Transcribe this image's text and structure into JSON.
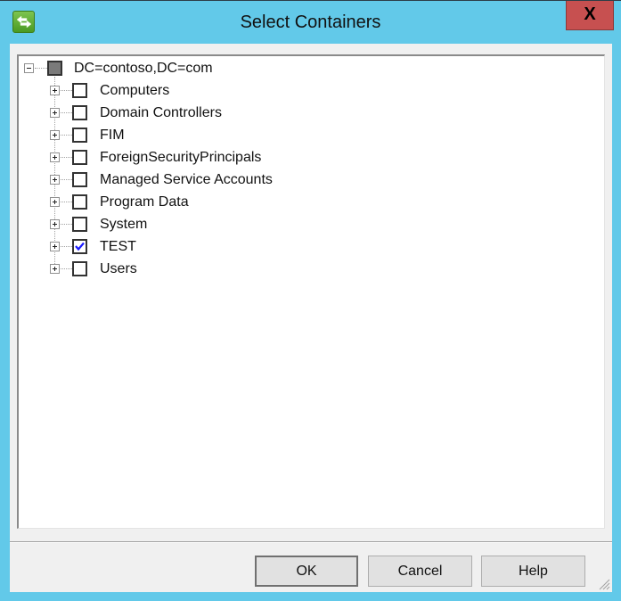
{
  "window": {
    "title": "Select Containers",
    "close_label": "X",
    "app_icon": "green-arrows-icon"
  },
  "tree": {
    "root": {
      "label": "DC=contoso,DC=com",
      "state": "indeterminate",
      "expanded": true
    },
    "children": [
      {
        "label": "Computers",
        "checked": false
      },
      {
        "label": "Domain Controllers",
        "checked": false
      },
      {
        "label": "FIM",
        "checked": false
      },
      {
        "label": "ForeignSecurityPrincipals",
        "checked": false
      },
      {
        "label": "Managed Service Accounts",
        "checked": false
      },
      {
        "label": "Program Data",
        "checked": false
      },
      {
        "label": "System",
        "checked": false
      },
      {
        "label": "TEST",
        "checked": true
      },
      {
        "label": "Users",
        "checked": false
      }
    ]
  },
  "buttons": {
    "ok": "OK",
    "cancel": "Cancel",
    "help": "Help"
  },
  "colors": {
    "titlebar": "#62c9e9",
    "close": "#c75050",
    "check": "#1a1aff"
  }
}
